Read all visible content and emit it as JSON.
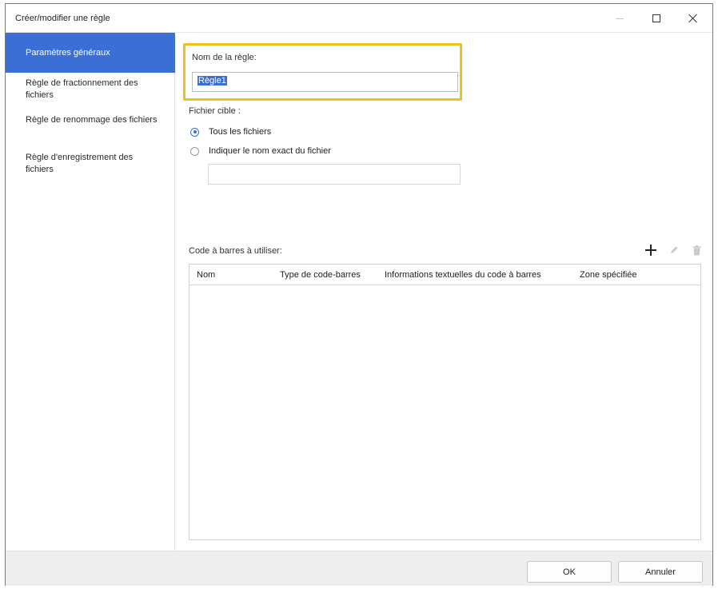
{
  "window": {
    "title": "Créer/modifier une règle"
  },
  "sidebar": {
    "items": [
      {
        "label": "Paramètres généraux",
        "active": true
      },
      {
        "label": "Règle de fractionnement des fichiers",
        "active": false
      },
      {
        "label": "Règle de renommage des fichiers",
        "active": false
      },
      {
        "label": "Règle d'enregistrement des fichiers",
        "active": false
      }
    ]
  },
  "general": {
    "rule_name_label": "Nom de la règle:",
    "rule_name_value": "Règle1",
    "target_file_label": "Fichier cible :",
    "option_all_files": "Tous les fichiers",
    "option_exact_name": "Indiquer le nom exact du fichier",
    "selected_option": "all_files",
    "exact_filename_value": ""
  },
  "barcodes": {
    "section_label": "Code à barres à utiliser:",
    "columns": [
      "Nom",
      "Type de code-barres",
      "Informations textuelles du code à barres",
      "Zone spécifiée"
    ],
    "rows": []
  },
  "icons": {
    "add": "plus-icon",
    "edit": "pencil-icon",
    "delete": "trash-icon"
  },
  "footer": {
    "ok_label": "OK",
    "cancel_label": "Annuler"
  },
  "colors": {
    "accent": "#3b6fd6",
    "highlight_border": "#f0c020",
    "footer_bg": "#eeeeee"
  }
}
